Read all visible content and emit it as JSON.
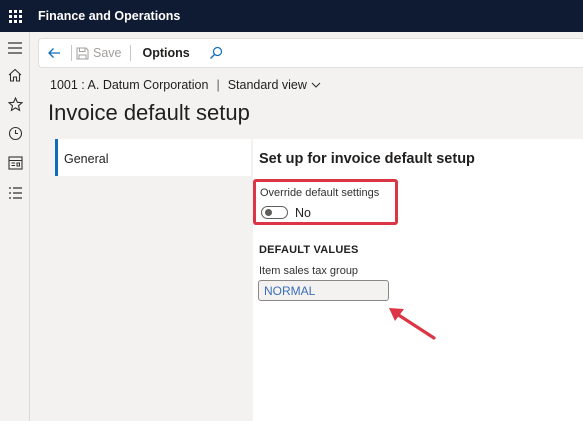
{
  "app": {
    "title": "Finance and Operations"
  },
  "toolbar": {
    "save_label": "Save",
    "options_label": "Options"
  },
  "breadcrumb": {
    "company": "1001 : A. Datum Corporation",
    "separator": "|",
    "view": "Standard view"
  },
  "page": {
    "title": "Invoice default setup"
  },
  "tabs": [
    {
      "label": "General",
      "selected": true
    }
  ],
  "form": {
    "section_title": "Set up for invoice default setup",
    "override": {
      "label": "Override default settings",
      "value": "No",
      "checked": false
    },
    "default_values": {
      "title": "DEFAULT VALUES",
      "item_sales_tax_group": {
        "label": "Item sales tax group",
        "value": "NORMAL"
      }
    }
  },
  "colors": {
    "topbar": "#0f1b33",
    "accent": "#0f6cbd",
    "highlight": "#dc3545",
    "link_value": "#3b6fb6"
  },
  "icons": [
    "waffle-icon",
    "hamburger-icon",
    "home-icon",
    "star-icon",
    "clock-icon",
    "workspace-icon",
    "list-icon",
    "back-arrow-icon",
    "save-icon",
    "search-icon",
    "chevron-down-icon"
  ]
}
